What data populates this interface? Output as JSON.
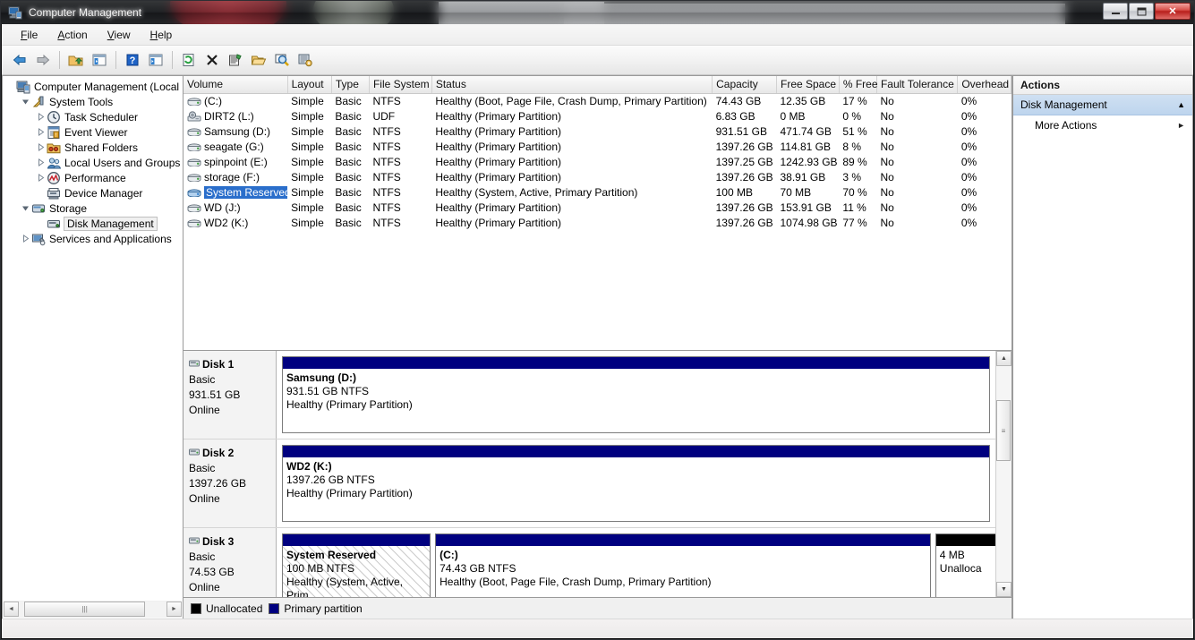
{
  "window": {
    "title": "Computer Management",
    "icon": "computer-management-icon",
    "minimize_label": "—",
    "maximize_label": "❐",
    "close_label": "✕"
  },
  "menubar": {
    "items": [
      {
        "label": "File",
        "accel": "F"
      },
      {
        "label": "Action",
        "accel": "A"
      },
      {
        "label": "View",
        "accel": "V"
      },
      {
        "label": "Help",
        "accel": "H"
      }
    ]
  },
  "toolbar": {
    "buttons": [
      {
        "name": "back-icon",
        "title": "Back"
      },
      {
        "name": "forward-icon",
        "title": "Forward"
      },
      {
        "name": "up-folder-icon",
        "title": "Up One Level"
      },
      {
        "name": "show-hide-tree-icon",
        "title": "Show/Hide Console Tree"
      },
      {
        "name": "help-icon",
        "title": "Help"
      },
      {
        "name": "show-hide-action-pane-icon",
        "title": "Show/Hide Action Pane"
      },
      {
        "name": "refresh-icon",
        "title": "Refresh"
      },
      {
        "name": "delete-icon",
        "title": "Delete"
      },
      {
        "name": "properties-icon",
        "title": "Properties"
      },
      {
        "name": "open-folder-icon",
        "title": "Open"
      },
      {
        "name": "rescan-disks-icon",
        "title": "Rescan Disks"
      },
      {
        "name": "export-list-icon",
        "title": "Export List"
      }
    ]
  },
  "tree": {
    "nodes": [
      {
        "label": "Computer Management (Local",
        "indent": 0,
        "expander": "collapsed-none",
        "icon": "computer-icon",
        "selected": false
      },
      {
        "label": "System Tools",
        "indent": 1,
        "expander": "expanded",
        "icon": "system-tools-icon",
        "selected": false
      },
      {
        "label": "Task Scheduler",
        "indent": 2,
        "expander": "collapsed",
        "icon": "task-scheduler-icon",
        "selected": false
      },
      {
        "label": "Event Viewer",
        "indent": 2,
        "expander": "collapsed",
        "icon": "event-viewer-icon",
        "selected": false
      },
      {
        "label": "Shared Folders",
        "indent": 2,
        "expander": "collapsed",
        "icon": "shared-folders-icon",
        "selected": false
      },
      {
        "label": "Local Users and Groups",
        "indent": 2,
        "expander": "collapsed",
        "icon": "local-users-icon",
        "selected": false
      },
      {
        "label": "Performance",
        "indent": 2,
        "expander": "collapsed",
        "icon": "performance-icon",
        "selected": false
      },
      {
        "label": "Device Manager",
        "indent": 2,
        "expander": "none",
        "icon": "device-manager-icon",
        "selected": false
      },
      {
        "label": "Storage",
        "indent": 1,
        "expander": "expanded",
        "icon": "storage-icon",
        "selected": false
      },
      {
        "label": "Disk Management",
        "indent": 2,
        "expander": "none",
        "icon": "disk-management-icon",
        "selected": true
      },
      {
        "label": "Services and Applications",
        "indent": 1,
        "expander": "collapsed",
        "icon": "services-icon",
        "selected": false
      }
    ],
    "hscroll": {
      "left_arrow": "◄",
      "right_arrow": "►",
      "grip": "|||"
    }
  },
  "volume_list": {
    "columns": [
      "Volume",
      "Layout",
      "Type",
      "File System",
      "Status",
      "Capacity",
      "Free Space",
      "% Free",
      "Fault Tolerance",
      "Overhead"
    ],
    "rows": [
      {
        "volume": "(C:)",
        "icon": "hdd-icon",
        "selected": false,
        "layout": "Simple",
        "type": "Basic",
        "fs": "NTFS",
        "status": "Healthy (Boot, Page File, Crash Dump, Primary Partition)",
        "capacity": "74.43 GB",
        "free": "12.35 GB",
        "pct": "17 %",
        "fault": "No",
        "overhead": "0%"
      },
      {
        "volume": "DIRT2 (L:)",
        "icon": "cdrom-icon",
        "selected": false,
        "layout": "Simple",
        "type": "Basic",
        "fs": "UDF",
        "status": "Healthy (Primary Partition)",
        "capacity": "6.83 GB",
        "free": "0 MB",
        "pct": "0 %",
        "fault": "No",
        "overhead": "0%"
      },
      {
        "volume": "Samsung (D:)",
        "icon": "hdd-icon",
        "selected": false,
        "layout": "Simple",
        "type": "Basic",
        "fs": "NTFS",
        "status": "Healthy (Primary Partition)",
        "capacity": "931.51 GB",
        "free": "471.74 GB",
        "pct": "51 %",
        "fault": "No",
        "overhead": "0%"
      },
      {
        "volume": "seagate (G:)",
        "icon": "hdd-icon",
        "selected": false,
        "layout": "Simple",
        "type": "Basic",
        "fs": "NTFS",
        "status": "Healthy (Primary Partition)",
        "capacity": "1397.26 GB",
        "free": "114.81 GB",
        "pct": "8 %",
        "fault": "No",
        "overhead": "0%"
      },
      {
        "volume": "spinpoint (E:)",
        "icon": "hdd-icon",
        "selected": false,
        "layout": "Simple",
        "type": "Basic",
        "fs": "NTFS",
        "status": "Healthy (Primary Partition)",
        "capacity": "1397.25 GB",
        "free": "1242.93 GB",
        "pct": "89 %",
        "fault": "No",
        "overhead": "0%"
      },
      {
        "volume": "storage (F:)",
        "icon": "hdd-icon",
        "selected": false,
        "layout": "Simple",
        "type": "Basic",
        "fs": "NTFS",
        "status": "Healthy (Primary Partition)",
        "capacity": "1397.26 GB",
        "free": "38.91 GB",
        "pct": "3 %",
        "fault": "No",
        "overhead": "0%"
      },
      {
        "volume": "System Reserved",
        "icon": "hdd-icon-blue",
        "selected": true,
        "layout": "Simple",
        "type": "Basic",
        "fs": "NTFS",
        "status": "Healthy (System, Active, Primary Partition)",
        "capacity": "100 MB",
        "free": "70 MB",
        "pct": "70 %",
        "fault": "No",
        "overhead": "0%"
      },
      {
        "volume": "WD (J:)",
        "icon": "hdd-icon",
        "selected": false,
        "layout": "Simple",
        "type": "Basic",
        "fs": "NTFS",
        "status": "Healthy (Primary Partition)",
        "capacity": "1397.26 GB",
        "free": "153.91 GB",
        "pct": "11 %",
        "fault": "No",
        "overhead": "0%"
      },
      {
        "volume": "WD2 (K:)",
        "icon": "hdd-icon",
        "selected": false,
        "layout": "Simple",
        "type": "Basic",
        "fs": "NTFS",
        "status": "Healthy (Primary Partition)",
        "capacity": "1397.26 GB",
        "free": "1074.98 GB",
        "pct": "77 %",
        "fault": "No",
        "overhead": "0%"
      }
    ]
  },
  "graph_view": {
    "disks": [
      {
        "name": "Disk 1",
        "type": "Basic",
        "size": "931.51 GB",
        "state": "Online",
        "partitions": [
          {
            "name": "Samsung  (D:)",
            "size_fs": "931.51 GB NTFS",
            "status": "Healthy (Primary Partition)",
            "kind": "primary",
            "width_pct": 100,
            "selected": false
          }
        ]
      },
      {
        "name": "Disk 2",
        "type": "Basic",
        "size": "1397.26 GB",
        "state": "Online",
        "partitions": [
          {
            "name": "WD2  (K:)",
            "size_fs": "1397.26 GB NTFS",
            "status": "Healthy (Primary Partition)",
            "kind": "primary",
            "width_pct": 100,
            "selected": false
          }
        ]
      },
      {
        "name": "Disk 3",
        "type": "Basic",
        "size": "74.53 GB",
        "state": "Online",
        "partitions": [
          {
            "name": "System Reserved",
            "size_fs": "100 MB NTFS",
            "status": "Healthy (System, Active, Prim",
            "kind": "primary",
            "width_pct": 21,
            "selected": true
          },
          {
            "name": "(C:)",
            "size_fs": "74.43 GB NTFS",
            "status": "Healthy (Boot, Page File, Crash Dump, Primary Partition)",
            "kind": "primary",
            "width_pct": 70,
            "selected": false
          },
          {
            "name": "",
            "size_fs": "4 MB",
            "status": "Unalloca",
            "kind": "unallocated",
            "width_pct": 9,
            "selected": false
          }
        ]
      }
    ],
    "vscroll": {
      "up_arrow": "▲",
      "down_arrow": "▼",
      "grip": "≡"
    }
  },
  "legend": {
    "items": [
      {
        "label": "Unallocated",
        "color": "#000000"
      },
      {
        "label": "Primary partition",
        "color": "#000080"
      }
    ]
  },
  "actions": {
    "header": "Actions",
    "group": {
      "label": "Disk Management",
      "collapse_glyph": "▲"
    },
    "items": [
      {
        "label": "More Actions",
        "arrow": "►"
      }
    ]
  },
  "colors": {
    "primary_partition": "#000080",
    "unallocated": "#000000",
    "selection_blue": "#2a6ecb",
    "actions_group_bg": "#c7daf0"
  }
}
